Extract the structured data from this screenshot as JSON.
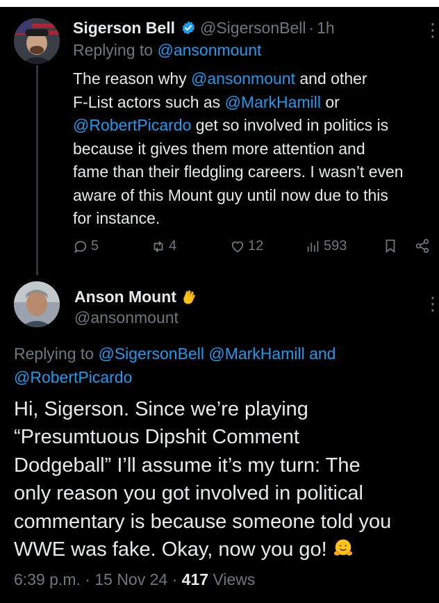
{
  "tweet1": {
    "author_name": "Sigerson Bell",
    "handle": "@SigersonBell",
    "separator": "·",
    "time": "1h",
    "replying_prefix": "Replying to ",
    "replying_to": "@ansonmount",
    "text": {
      "l1_a": "The reason why ",
      "l1_link": "@ansonmount",
      "l1_b": " and other",
      "l2_a": "F-List actors such as ",
      "l2_link": "@MarkHamill",
      "l2_b": " or",
      "l3_link": "@RobertPicardo",
      "l3_b": " get so involved in politics is",
      "l4": "because it gives them more attention and",
      "l5": "fame than their fledgling careers. I wasn’t even",
      "l6": "aware of this Mount guy until now due to this",
      "l7": "for instance."
    },
    "stats": {
      "replies": "5",
      "reposts": "4",
      "likes": "12",
      "views": "593"
    },
    "icons": [
      "reply-icon",
      "repost-icon",
      "like-icon",
      "views-icon",
      "bookmark-icon",
      "share-icon"
    ],
    "verified_color": "#1d9bf0"
  },
  "tweet2": {
    "author_name": "Anson Mount",
    "name_emoji_icon": "vulcan-salute-icon",
    "handle": "@ansonmount",
    "replying_prefix": "Replying to ",
    "replying_mention1": "@SigersonBell",
    "replying_mention2": "@MarkHamill",
    "replying_and": " and",
    "replying_mention3": "@RobertPicardo",
    "text": {
      "l1": "Hi, Sigerson. Since we’re playing",
      "l2": "“Presumtuous Dipshit Comment",
      "l3": "Dodgeball” I’ll assume it’s my turn: The",
      "l4": "only reason you got involved in political",
      "l5": "commentary is because someone told you",
      "l6": "WWE was fake. Okay, now you go! "
    },
    "end_emoji_icon": "hugging-face-icon",
    "timestamp": "6:39 p.m.",
    "sep": " · ",
    "date": "15 Nov 24",
    "views_count": "417",
    "views_label": " Views"
  },
  "colors": {
    "background": "#000000",
    "text": "#e7e9ea",
    "muted": "#71767b",
    "link": "#1d9bf0"
  }
}
